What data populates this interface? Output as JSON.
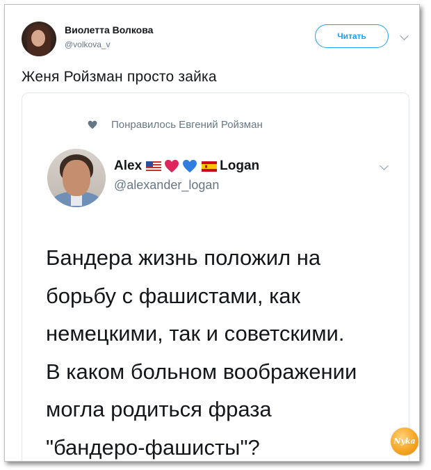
{
  "author": {
    "name": "Виолетта Волкова",
    "handle": "@volkova_v",
    "follow_label": "Читать"
  },
  "tweet": {
    "text": "Женя Ройзман просто зайка"
  },
  "quoted": {
    "liked_text": "Понравилось Евгений Ройзман",
    "name_prefix": "Alex",
    "name_suffix": "Logan",
    "handle": "@alexander_logan",
    "body_lines": [
      "Бандера жизнь положил на",
      "борьбу с фашистами, как",
      "немецкими, так и советскими.",
      "В каком больном воображении",
      "могла родиться фраза",
      "\"бандеро-фашисты\"?"
    ],
    "name_icons": [
      "us-flag-icon",
      "red-heart-icon",
      "blue-heart-icon",
      "spain-flag-icon"
    ]
  },
  "watermark": {
    "text": "Nyka"
  },
  "colors": {
    "accent": "#1da1f2",
    "secondary_text": "#657786"
  }
}
